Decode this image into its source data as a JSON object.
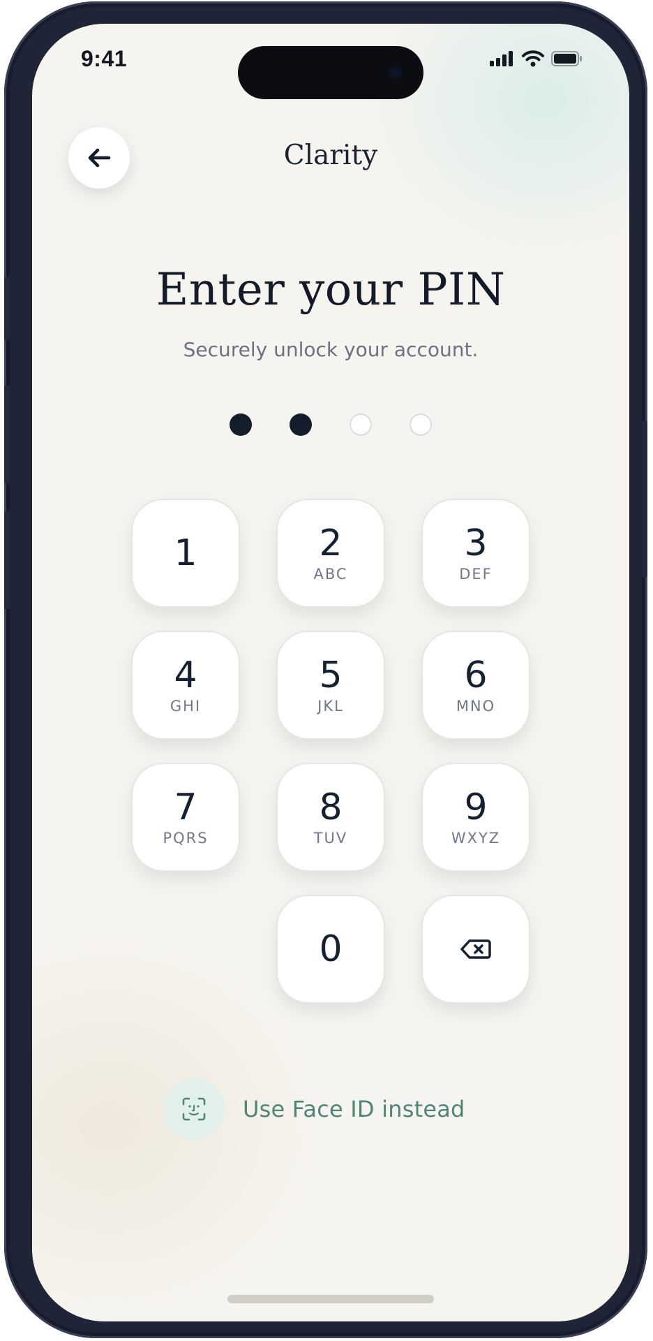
{
  "status_bar": {
    "time": "9:41",
    "icons": [
      "signal-icon",
      "wifi-icon",
      "battery-icon"
    ]
  },
  "header": {
    "back_icon": "arrow-left-icon",
    "app_title": "Clarity"
  },
  "main": {
    "title": "Enter your PIN",
    "subtitle": "Securely unlock your account.",
    "pin": {
      "length": 4,
      "entered": 2
    }
  },
  "keypad": {
    "keys": [
      {
        "num": "1",
        "letters": ""
      },
      {
        "num": "2",
        "letters": "ABC"
      },
      {
        "num": "3",
        "letters": "DEF"
      },
      {
        "num": "4",
        "letters": "GHI"
      },
      {
        "num": "5",
        "letters": "JKL"
      },
      {
        "num": "6",
        "letters": "MNO"
      },
      {
        "num": "7",
        "letters": "PQRS"
      },
      {
        "num": "8",
        "letters": "TUV"
      },
      {
        "num": "9",
        "letters": "WXYZ"
      },
      {
        "num": "0",
        "letters": ""
      }
    ],
    "delete_icon": "backspace-icon"
  },
  "face_id": {
    "icon": "face-id-icon",
    "label": "Use Face ID instead"
  },
  "colors": {
    "background": "#f6f4ef",
    "ink": "#141d2b",
    "accent_green": "#4f8578",
    "accent_green_light": "#e2f0ec"
  }
}
